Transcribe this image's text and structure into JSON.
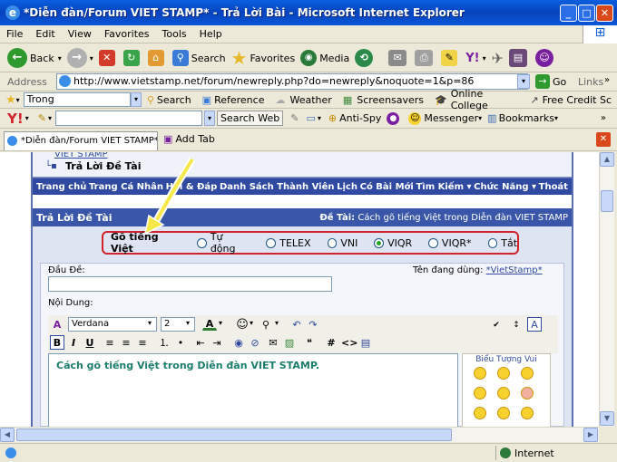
{
  "window": {
    "title": "*Diễn đàn/Forum VIET STAMP* - Trả Lời Bài - Microsoft Internet Explorer",
    "min": "_",
    "max": "□",
    "close": "✕"
  },
  "menu": [
    "File",
    "Edit",
    "View",
    "Favorites",
    "Tools",
    "Help"
  ],
  "toolbar": {
    "back": "Back",
    "search": "Search",
    "favorites": "Favorites",
    "media": "Media"
  },
  "address": {
    "label": "Address",
    "url": "http://www.vietstamp.net/forum/newreply.php?do=newreply&noquote=1&p=86",
    "go": "Go",
    "links": "Links"
  },
  "linksbar": {
    "input": "Trong",
    "search": "Search",
    "reference": "Reference",
    "weather": "Weather",
    "screensavers": "Screensavers",
    "online_college": "Online College",
    "free_credit": "Free Credit Sc"
  },
  "yahoo": {
    "search_web": "Search Web",
    "anti_spy": "Anti-Spy",
    "messenger": "Messenger",
    "bookmarks": "Bookmarks"
  },
  "tabs": {
    "tab1": "*Diễn đàn/Forum VIET STAMP* ...",
    "add": "Add Tab"
  },
  "forum": {
    "breadcrumb_site": "VIET STAMP",
    "breadcrumb_page": "Trả Lời Đề Tài",
    "nav": [
      "Trang chủ",
      "Trang Cá Nhân",
      "Hỏi & Đáp",
      "Danh Sách Thành Viên",
      "Lịch",
      "Có Bài Mới",
      "Tìm Kiếm ▾",
      "Chức Năng ▾",
      "Thoát"
    ],
    "panel_title": "Trả Lời Đề Tài",
    "topic_label": "Đề Tài:",
    "topic": "Cách gõ tiếng Việt trong Diễn đàn VIET STAMP",
    "typing_label": "Gõ tiếng Việt",
    "typing_options": [
      "Tự động",
      "TELEX",
      "VNI",
      "VIQR",
      "VIQR*",
      "Tắt"
    ],
    "typing_selected": "VIQR",
    "title_label": "Đầu Đề:",
    "user_label": "Tên đang dùng:",
    "username": "*VietStamp*",
    "content_label": "Nội Dung:",
    "font": "Verdana",
    "size": "2",
    "editor_text": "Cách gõ tiếng Việt trong Diễn đàn VIET STAMP.",
    "smilies_title": "Biểu Tượng Vui"
  },
  "status": {
    "zone": "Internet"
  }
}
